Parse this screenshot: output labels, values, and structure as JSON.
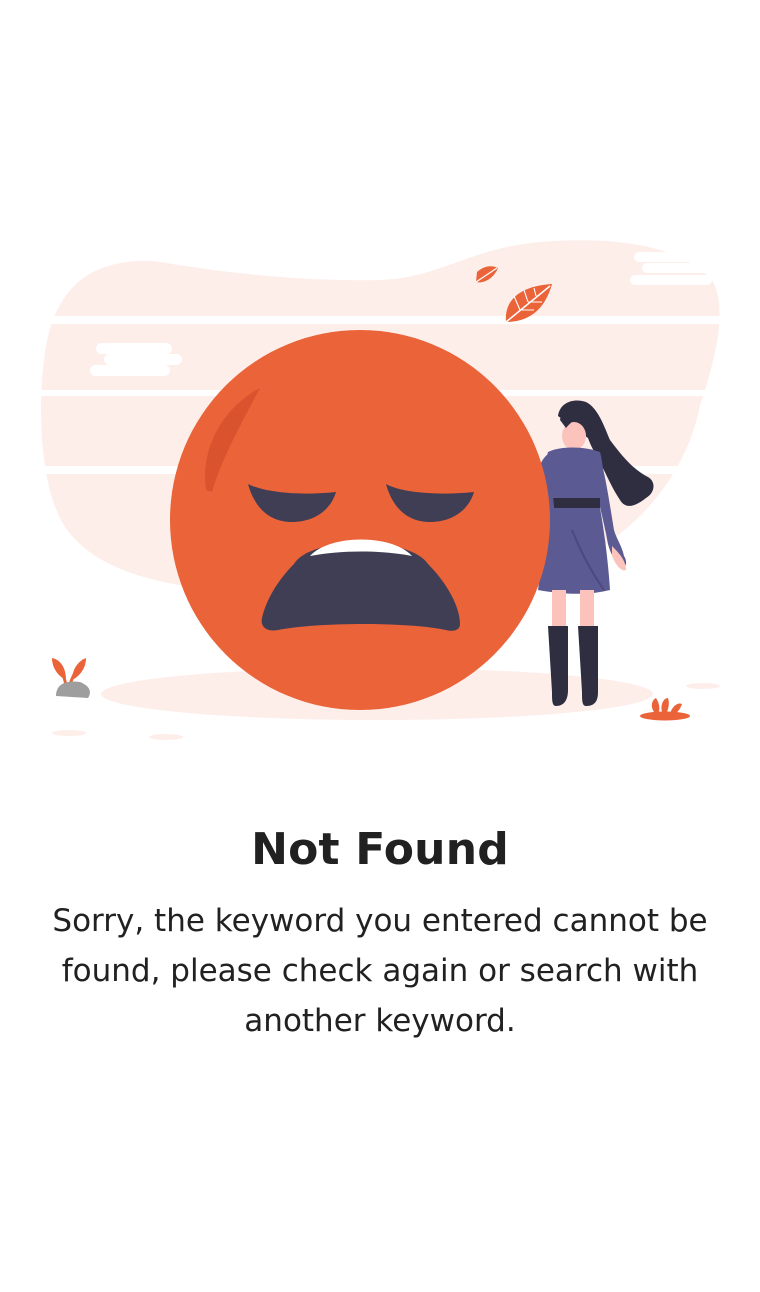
{
  "empty_state": {
    "title": "Not Found",
    "message": "Sorry, the keyword you entered cannot be found, please check again or search with another keyword."
  },
  "illustration": {
    "icon": "crying-face-with-woman-illustration",
    "colors": {
      "accent": "#EA6339",
      "accent_dark": "#D9542E",
      "background_blob": "#FDEEEA",
      "dark": "#403E55",
      "dress": "#5B5A92",
      "skin": "#FBC3BB",
      "hair": "#2F2E41"
    }
  }
}
